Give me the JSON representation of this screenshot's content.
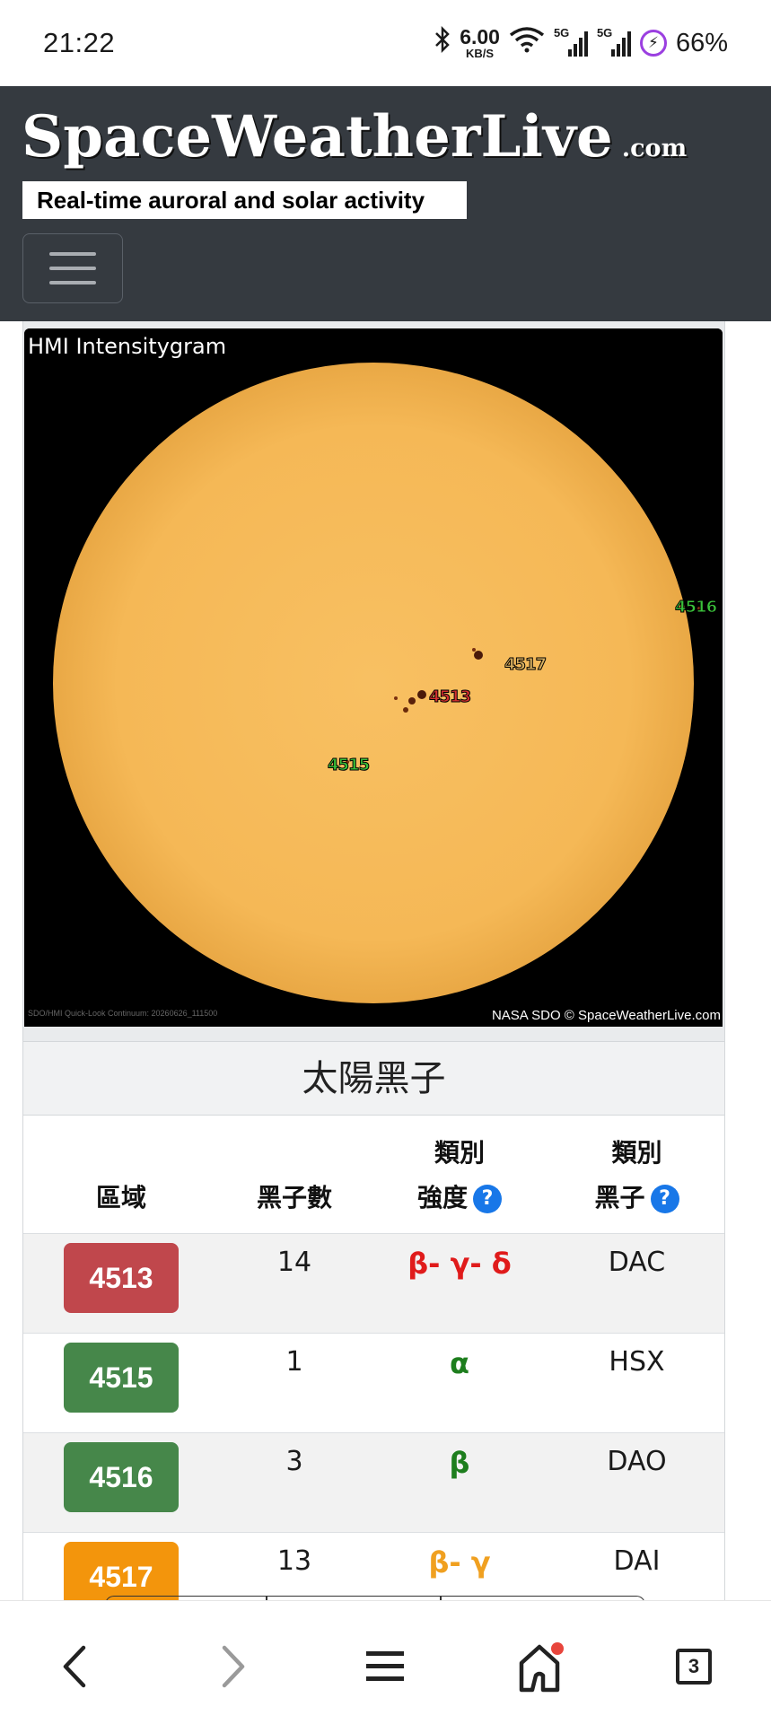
{
  "status_bar": {
    "time": "21:22",
    "net_speed_value": "6.00",
    "net_speed_unit": "KB/S",
    "network_1": "5G",
    "network_2": "5G",
    "battery": "66%"
  },
  "site": {
    "logo_name": "SpaceWeatherLive",
    "logo_tld": ".com",
    "tagline": "Real-time auroral and solar activity"
  },
  "sun_image": {
    "title": "HMI Intensitygram",
    "credit": "NASA SDO © SpaceWeatherLive.com",
    "caption": "SDO/HMI Quick-Look Continuum: 20260626_111500",
    "region_labels": [
      {
        "id": "4516",
        "color": "#3ac13a"
      },
      {
        "id": "4517",
        "color": "#d8b060"
      },
      {
        "id": "4513",
        "color": "#d43030"
      },
      {
        "id": "4515",
        "color": "#3ac13a"
      }
    ]
  },
  "sunspots": {
    "title": "太陽黑子",
    "headers": {
      "region": "區域",
      "count": "黑子數",
      "mag_line1": "類別",
      "mag_line2": "強度",
      "spot_line1": "類別",
      "spot_line2": "黑子",
      "help": "?"
    },
    "rows": [
      {
        "region": "4513",
        "count": "14",
        "mag_class": "β- γ- δ",
        "spot_class": "DAC",
        "badge_color": "#c0474c",
        "mag_color": "#e01b1b"
      },
      {
        "region": "4515",
        "count": "1",
        "mag_class": "α",
        "spot_class": "HSX",
        "badge_color": "#46874a",
        "mag_color": "#1e7e1e"
      },
      {
        "region": "4516",
        "count": "3",
        "mag_class": "β",
        "spot_class": "DAO",
        "badge_color": "#46874a",
        "mag_color": "#1e7e1e"
      },
      {
        "region": "4517",
        "count": "13",
        "mag_class": "β- γ",
        "spot_class": "DAI",
        "badge_color": "#f3950c",
        "mag_color": "#f0a020"
      }
    ]
  },
  "nav": {
    "tabs_count": "3",
    "icons": [
      "back-arrow-icon",
      "forward-arrow-icon",
      "menu-icon",
      "home-icon",
      "tabs-icon"
    ]
  },
  "colors": {
    "header_bg": "#353a40",
    "sun": "#f7bb5a",
    "accent_blue": "#1877e8",
    "notification_dot": "#e8453c"
  }
}
